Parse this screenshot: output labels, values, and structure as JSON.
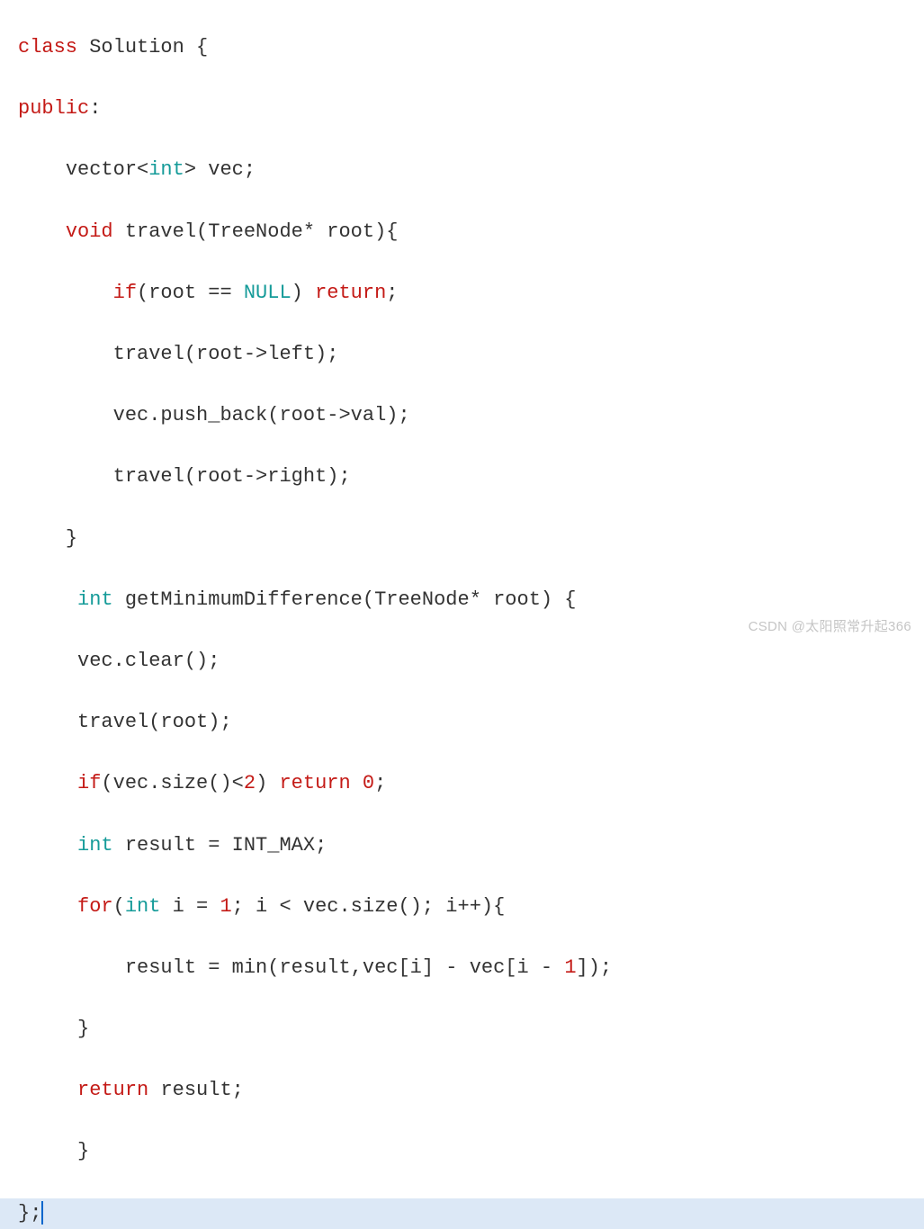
{
  "code_tokens": {
    "L1": {
      "class": "class",
      "name": "Solution",
      "open": "{"
    },
    "L2": {
      "public": "public",
      "colon": ":"
    },
    "L3": {
      "vector": "vector",
      "lt": "<",
      "int": "int",
      "gt": ">",
      "vec": "vec;"
    },
    "L4": {
      "void": "void",
      "fn": "travel(TreeNode* root){"
    },
    "L5": {
      "if": "if",
      "cond": "(root == ",
      "null": "NULL",
      "close": ") ",
      "return": "return",
      "semi": ";"
    },
    "L6": {
      "call": "travel(root->left);"
    },
    "L7": {
      "call": "vec.push_back(root->val);"
    },
    "L8": {
      "call": "travel(root->right);"
    },
    "L9": {
      "close": "}"
    },
    "L10": {
      "int": "int",
      "sig": "getMinimumDifference(TreeNode* root) {"
    },
    "L11": {
      "call": "vec.clear();"
    },
    "L12": {
      "call": "travel(root);"
    },
    "L13": {
      "if": "if",
      "cond1": "(vec.size()<",
      "two": "2",
      "cond2": ") ",
      "return": "return",
      "sp": " ",
      "zero": "0",
      "semi": ";"
    },
    "L14": {
      "int": "int",
      "rest": "result = INT_MAX;"
    },
    "L15": {
      "for": "for",
      "open": "(",
      "int": "int",
      "i": "i = ",
      "one": "1",
      "cond": "; i < vec.size(); i++){"
    },
    "L16": {
      "body1": "result = min(result,vec[i] - vec[i - ",
      "one": "1",
      "body2": "]);"
    },
    "L17": {
      "close": "}"
    },
    "L18": {
      "return": "return",
      "val": "result;"
    },
    "L19": {
      "close": "}"
    },
    "L20": {
      "close": "};"
    }
  },
  "watermark": "CSDN @太阳照常升起366"
}
